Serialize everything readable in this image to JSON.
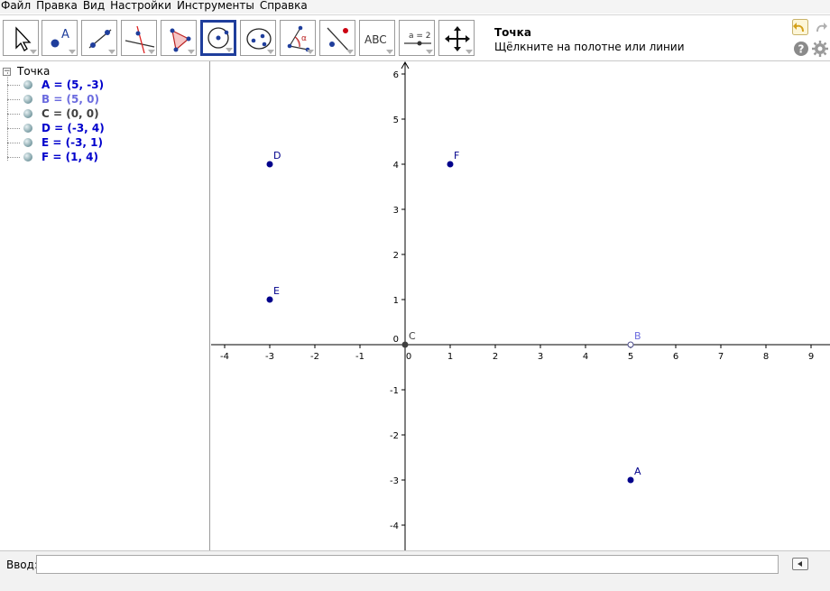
{
  "menu": [
    "Файл",
    "Правка",
    "Вид",
    "Настройки",
    "Инструменты",
    "Справка"
  ],
  "toolbar": {
    "tools": [
      {
        "name": "move-tool",
        "icon": "arrow-cursor-icon"
      },
      {
        "name": "point-tool",
        "icon": "point-icon",
        "letter": "A"
      },
      {
        "name": "line-tool",
        "icon": "line-through-points-icon"
      },
      {
        "name": "perpendicular-tool",
        "icon": "perpendicular-line-icon"
      },
      {
        "name": "polygon-tool",
        "icon": "polygon-icon"
      },
      {
        "name": "circle-tool",
        "icon": "circle-center-point-icon",
        "selected": true
      },
      {
        "name": "ellipse-tool",
        "icon": "ellipse-icon"
      },
      {
        "name": "angle-tool",
        "icon": "angle-icon",
        "letter": "α"
      },
      {
        "name": "reflect-tool",
        "icon": "reflect-about-line-icon"
      },
      {
        "name": "text-tool",
        "icon": "text-icon",
        "letter": "ABC"
      },
      {
        "name": "slider-tool",
        "icon": "slider-icon",
        "letter": "a = 2"
      },
      {
        "name": "move-view-tool",
        "icon": "move-graphics-view-icon"
      }
    ],
    "active_tool_title": "Точка",
    "active_tool_help": "Щёлкните на полотне или линии"
  },
  "algebra": {
    "group_label": "Точка",
    "objects": [
      {
        "text": "A = (5, -3)",
        "color": "#0000cc"
      },
      {
        "text": "B = (5, 0)",
        "color": "#6b6bdf"
      },
      {
        "text": "C = (0, 0)",
        "color": "#404040"
      },
      {
        "text": "D = (-3, 4)",
        "color": "#0000cc"
      },
      {
        "text": "E = (-3, 1)",
        "color": "#0000cc"
      },
      {
        "text": "F = (1, 4)",
        "color": "#0000cc"
      }
    ]
  },
  "graphics": {
    "x_ticks": [
      -4,
      -3,
      -2,
      -1,
      0,
      1,
      2,
      3,
      4,
      5,
      6,
      7,
      8,
      9
    ],
    "y_ticks": [
      6,
      5,
      4,
      3,
      2,
      1,
      0,
      -1,
      -2,
      -3,
      -4
    ],
    "points": [
      {
        "label": "A",
        "x": 5,
        "y": -3,
        "color": "#00008b"
      },
      {
        "label": "B",
        "x": 5,
        "y": 0,
        "color": "#6b6bdf",
        "hollow": true
      },
      {
        "label": "C",
        "x": 0,
        "y": 0,
        "color": "#404040"
      },
      {
        "label": "D",
        "x": -3,
        "y": 4,
        "color": "#00008b"
      },
      {
        "label": "E",
        "x": -3,
        "y": 1,
        "color": "#00008b"
      },
      {
        "label": "F",
        "x": 1,
        "y": 4,
        "color": "#00008b"
      }
    ]
  },
  "input": {
    "label": "Ввод:",
    "value": ""
  }
}
